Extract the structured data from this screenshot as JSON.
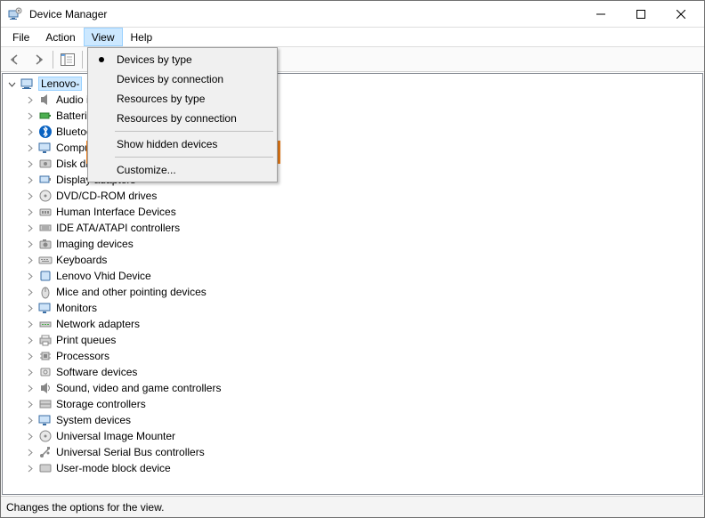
{
  "window": {
    "title": "Device Manager"
  },
  "menu": {
    "file": "File",
    "action": "Action",
    "view": "View",
    "help": "Help"
  },
  "dropdown": {
    "devices_by_type": "Devices by type",
    "devices_by_connection": "Devices by connection",
    "resources_by_type": "Resources by type",
    "resources_by_connection": "Resources by connection",
    "show_hidden": "Show hidden devices",
    "customize": "Customize..."
  },
  "root": {
    "name": "Lenovo-"
  },
  "devices": {
    "audio": "Audio inputs and outputs",
    "batteries": "Batteries",
    "bluetooth": "Bluetooth",
    "computer": "Computer",
    "disk": "Disk drives",
    "display": "Display adapters",
    "dvd": "DVD/CD-ROM drives",
    "hid": "Human Interface Devices",
    "ide": "IDE ATA/ATAPI controllers",
    "imaging": "Imaging devices",
    "keyboards": "Keyboards",
    "lenovo_vhid": "Lenovo Vhid Device",
    "mice": "Mice and other pointing devices",
    "monitors": "Monitors",
    "network": "Network adapters",
    "print": "Print queues",
    "processors": "Processors",
    "software": "Software devices",
    "sound": "Sound, video and game controllers",
    "storage": "Storage controllers",
    "system": "System devices",
    "uim": "Universal Image Mounter",
    "usb": "Universal Serial Bus controllers",
    "usermode": "User-mode block device"
  },
  "status": {
    "text": "Changes the options for the view."
  }
}
